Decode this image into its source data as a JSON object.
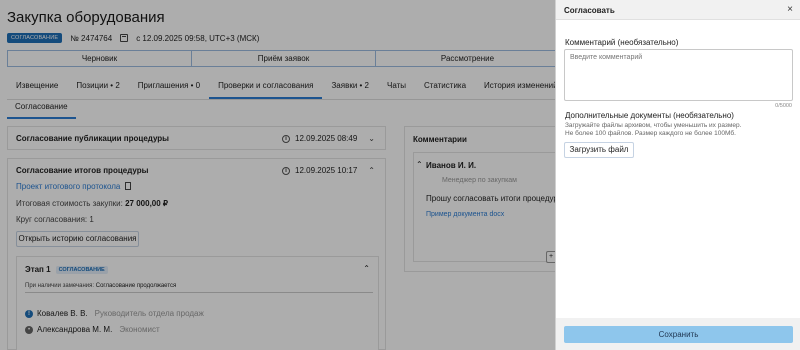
{
  "header": {
    "title": "Закупка оборудования",
    "status_badge": "СОГЛАСОВАНИЕ",
    "number": "№ 2474764",
    "date_range": "с 12.09.2025 09:58, UTC+3 (МСК)"
  },
  "steps": [
    "Черновик",
    "Приём заявок",
    "Рассмотрение"
  ],
  "tabs": [
    "Извещение",
    "Позиции • 2",
    "Приглашения • 0",
    "Проверки и согласования",
    "Заявки • 2",
    "Чаты",
    "Статистика",
    "История изменений"
  ],
  "active_tab": "Проверки и согласования",
  "subtab": "Согласование",
  "card_publication": {
    "title": "Согласование публикации процедуры",
    "date": "12.09.2025 08:49"
  },
  "card_results": {
    "title": "Согласование итогов процедуры",
    "date": "12.09.2025 10:17",
    "protocol_link": "Проект итогового протокола",
    "cost_label": "Итоговая стоимость закупки:",
    "cost_value": "27 000,00 ₽",
    "circle_label": "Круг согласования: 1",
    "history_button": "Открыть историю согласования"
  },
  "stage": {
    "title": "Этап 1",
    "badge": "СОГЛАСОВАНИЕ",
    "note_prefix": "При наличии замечания:",
    "note_value": "Согласование продолжается",
    "approvers": [
      {
        "name": "Ковалев В. В.",
        "role": "Руководитель отдела продаж"
      },
      {
        "name": "Александрова М. М.",
        "role": "Экономист"
      }
    ]
  },
  "comments": {
    "title": "Комментарии",
    "author": "Иванов И. И.",
    "role": "Менеджер по закупкам",
    "text": "Прошу согласовать итоги процедуры",
    "link": "Пример документа docx"
  },
  "panel": {
    "title": "Согласовать",
    "comment_label": "Комментарий (необязательно)",
    "comment_placeholder": "Введите комментарий",
    "counter": "0/5000",
    "docs_label": "Дополнительные документы (необязательно)",
    "docs_hint_1": "Загружайте файлы архивом, чтобы уменьшить их размер.",
    "docs_hint_2": "Не более 100 файлов. Размер каждого не более 100Мб.",
    "upload_button": "Загрузить файл",
    "save_button": "Сохранить"
  }
}
